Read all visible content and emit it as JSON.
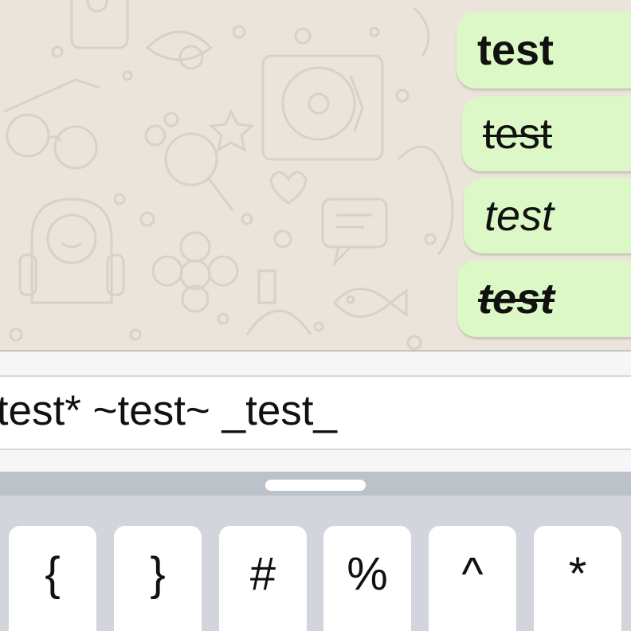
{
  "chat": {
    "messages": [
      {
        "text": "test",
        "style": "bold"
      },
      {
        "text": "test",
        "style": "strikethrough"
      },
      {
        "text": "test",
        "style": "italic"
      },
      {
        "text": "test",
        "style": "bold-italic-strikethrough"
      }
    ]
  },
  "composer": {
    "text": "*test* ~test~ _test_"
  },
  "keyboard": {
    "keys": [
      "{",
      "}",
      "#",
      "%",
      "^",
      "*"
    ]
  },
  "colors": {
    "wallpaper": "#ebe4da",
    "outgoing_bubble": "#dcf8c6",
    "keyboard": "#d2d5db",
    "key": "#ffffff"
  },
  "icons": [
    "chat-wallpaper-doodles"
  ]
}
